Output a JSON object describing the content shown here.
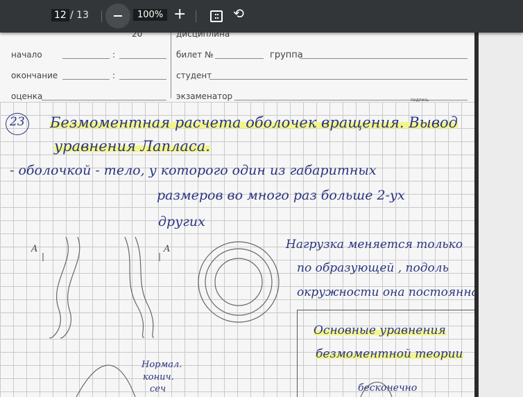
{
  "toolbar": {
    "page_current": "12",
    "page_total": "/ 13",
    "zoom": "100%",
    "zoom_out": "−",
    "zoom_in": "+",
    "fit_icon": "fit-page-icon",
    "rotate_icon": "rotate-icon"
  },
  "form": {
    "top_date": "20",
    "top_discipline": "дисциплина",
    "start": "начало",
    "end": "окончание",
    "grade": "оценка",
    "ticket": "билет №",
    "group": "группа",
    "student": "студент",
    "examiner": "экзаменатор",
    "signature": "подпись",
    "colon": ":"
  },
  "notes": {
    "number": "23",
    "title1": "Безмоментная расчета оболочек вращения. Вывод",
    "title2": "уравнения Лапласа.",
    "def1": "- оболочкой  -  тело, у которого один из габаритных",
    "def2": "размеров во много раз больше 2-ух",
    "def3": "других",
    "load1": "Нагрузка меняется только",
    "load2": "по образующей , подоль",
    "load3": "окружности она постоянна.",
    "box1": "Основные уравнения",
    "box2": "безмоментной теории",
    "normal1": "Нормал.",
    "normal2": "конич.",
    "normal3": "сеч",
    "infinite": "бесконечно",
    "label_a": "A"
  }
}
